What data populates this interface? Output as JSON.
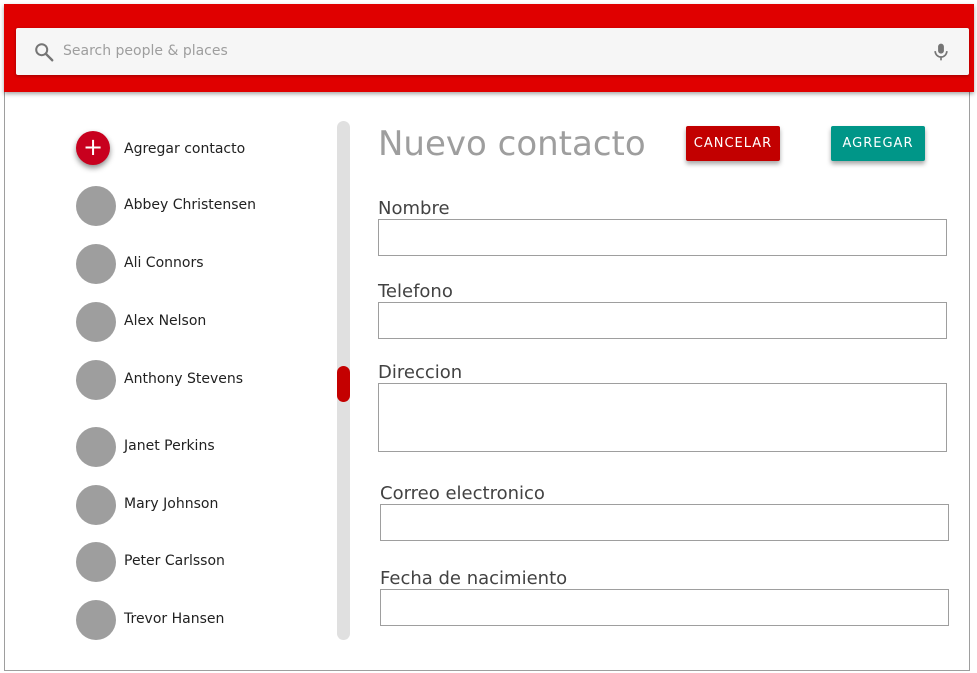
{
  "search": {
    "placeholder": "Search people & places"
  },
  "contacts": {
    "add_label": "Agregar contacto",
    "add_symbol": "+",
    "items": [
      {
        "name": "Abbey Christensen"
      },
      {
        "name": "Ali Connors"
      },
      {
        "name": "Alex Nelson"
      },
      {
        "name": "Anthony Stevens"
      },
      {
        "name": "Janet Perkins"
      },
      {
        "name": "Mary Johnson"
      },
      {
        "name": "Peter Carlsson"
      },
      {
        "name": "Trevor Hansen"
      }
    ]
  },
  "form": {
    "title": "Nuevo contacto",
    "cancel_label": "CANCELAR",
    "add_label": "AGREGAR",
    "fields": {
      "nombre": {
        "label": "Nombre",
        "value": ""
      },
      "telefono": {
        "label": "Telefono",
        "value": ""
      },
      "direccion": {
        "label": "Direccion",
        "value": ""
      },
      "correo": {
        "label": "Correo electronico",
        "value": ""
      },
      "fecha": {
        "label": "Fecha de nacimiento",
        "value": ""
      }
    }
  },
  "colors": {
    "app_bar": "#e00000",
    "cancel_button": "#c20000",
    "add_button": "#009688",
    "avatar": "#9e9e9e"
  },
  "icons": {
    "search": "search-icon",
    "mic": "microphone-icon",
    "add": "plus-icon"
  }
}
